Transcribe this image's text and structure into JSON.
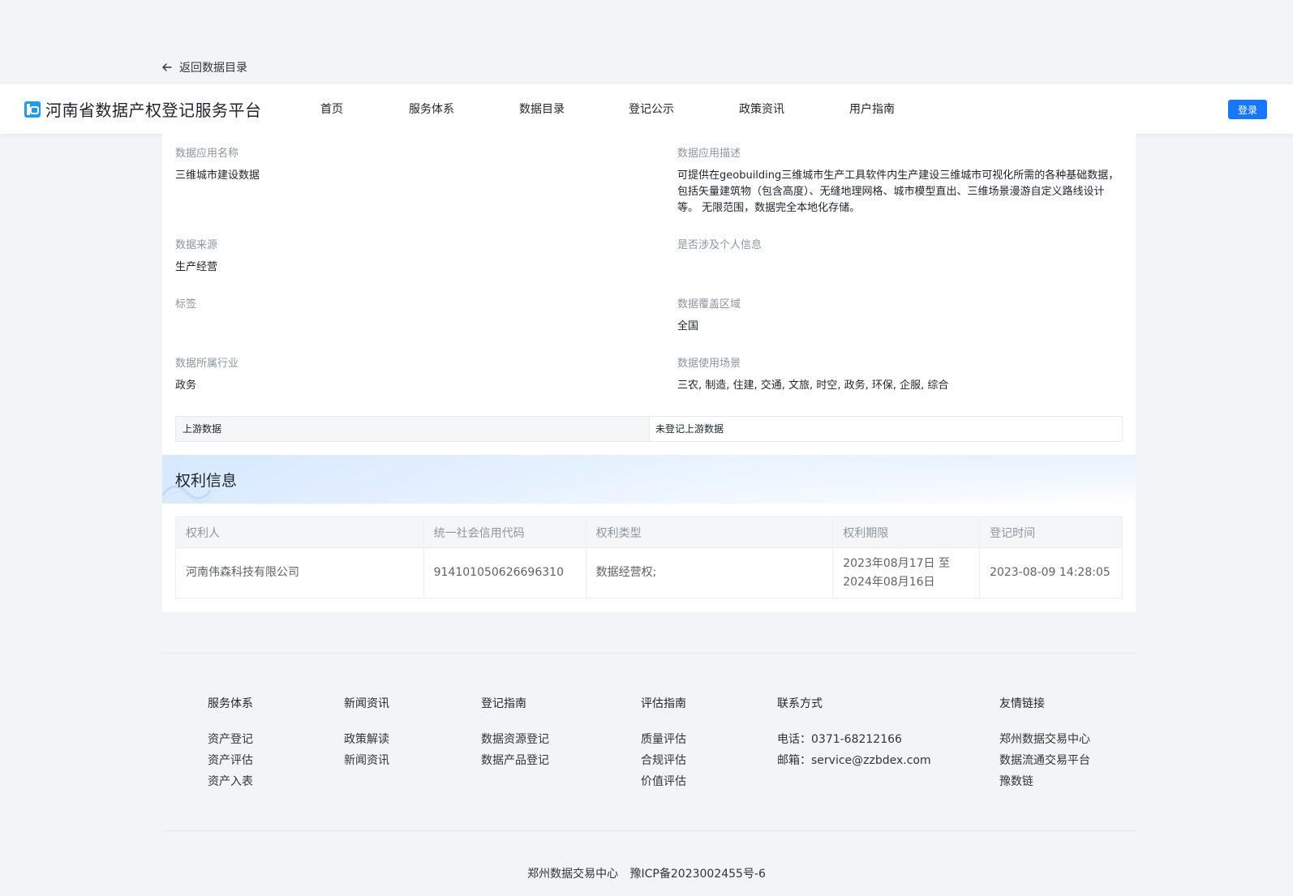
{
  "back_link": {
    "label": "返回数据目录"
  },
  "header": {
    "brand": "河南省数据产权登记服务平台",
    "nav": [
      "首页",
      "服务体系",
      "数据目录",
      "登记公示",
      "政策资讯",
      "用户指南"
    ],
    "login_label": "登录"
  },
  "details": {
    "app_name": {
      "label": "数据应用名称",
      "value": "三维城市建设数据"
    },
    "app_desc": {
      "label": "数据应用描述",
      "value": "可提供在geobuilding三维城市生产工具软件内生产建设三维城市可视化所需的各种基础数据，包括矢量建筑物（包含高度）、无缝地理网格、城市模型直出、三维场景漫游自定义路线设计等。 无限范围，数据完全本地化存储。"
    },
    "source": {
      "label": "数据来源",
      "value": "生产经营"
    },
    "personal_info": {
      "label": "是否涉及个人信息",
      "value": ""
    },
    "tags": {
      "label": "标签",
      "value": ""
    },
    "coverage": {
      "label": "数据覆盖区域",
      "value": "全国"
    },
    "industry": {
      "label": "数据所属行业",
      "value": "政务"
    },
    "scenarios": {
      "label": "数据使用场景",
      "value": "三农, 制造, 住建, 交通, 文旅, 时空, 政务, 环保, 企服, 综合"
    },
    "upstream": {
      "label": "上游数据",
      "value": "未登记上游数据"
    }
  },
  "rights": {
    "title": "权利信息",
    "columns": [
      "权利人",
      "统一社会信用代码",
      "权利类型",
      "权利期限",
      "登记时间"
    ],
    "rows": [
      {
        "holder": "河南伟森科技有限公司",
        "credit_code": "914101050626696310",
        "type": "数据经营权;",
        "period_start": "2023年08月17日 至",
        "period_end": "2024年08月16日",
        "reg_time": "2023-08-09 14:28:05"
      }
    ]
  },
  "footer": {
    "columns": [
      {
        "heading": "服务体系",
        "items": [
          "资产登记",
          "资产评估",
          "资产入表"
        ]
      },
      {
        "heading": "新闻资讯",
        "items": [
          "政策解读",
          "新闻资讯"
        ]
      },
      {
        "heading": "登记指南",
        "items": [
          "数据资源登记",
          "数据产品登记"
        ]
      },
      {
        "heading": "评估指南",
        "items": [
          "质量评估",
          "合规评估",
          "价值评估"
        ]
      },
      {
        "heading": "联系方式",
        "items": [
          "电话：0371-68212166",
          "邮箱：service@zzbdex.com"
        ]
      },
      {
        "heading": "友情链接",
        "items": [
          "郑州数据交易中心",
          "数据流通交易平台",
          "豫数链"
        ]
      }
    ],
    "org": "郑州数据交易中心",
    "icp": "豫ICP备2023002455号-6"
  },
  "colors": {
    "primary": "#1677ff",
    "background": "#f2f4f8"
  },
  "icons": {
    "back": "arrow-left-icon",
    "logo": "platform-logo-icon"
  }
}
